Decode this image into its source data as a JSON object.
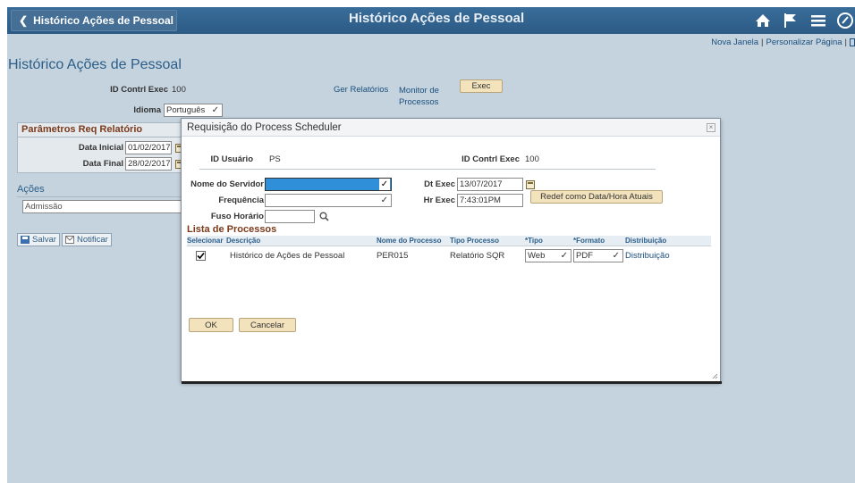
{
  "header": {
    "back_label": "Histórico Ações de Pessoal",
    "title": "Histórico Ações de Pessoal",
    "icons": [
      "home-icon",
      "flag-icon",
      "menu-icon",
      "navbar-icon"
    ]
  },
  "top_links": {
    "new_window": "Nova Janela",
    "personalize": "Personalizar Página"
  },
  "page": {
    "title": "Histórico Ações de Pessoal",
    "run_control_label": "ID Contrl Exec",
    "run_control_value": "100",
    "language_label": "Idioma",
    "language_value": "Português",
    "report_manager": "Ger Relatórios",
    "process_monitor": "Monitor de Processos",
    "run_button": "Exec"
  },
  "params": {
    "title": "Parâmetros Req Relatório",
    "start_label": "Data Inicial",
    "start_value": "01/02/2017",
    "end_label": "Data Final",
    "end_value": "28/02/2017"
  },
  "actions": {
    "title": "Ações",
    "value": "Admissão"
  },
  "side_buttons": {
    "save": "Salvar",
    "notify": "Notificar"
  },
  "modal": {
    "title": "Requisição do Process Scheduler",
    "user_label": "ID Usuário",
    "user_value": "PS",
    "run_control_label": "ID Contrl Exec",
    "run_control_value": "100",
    "server_label": "Nome do Servidor",
    "server_value": "",
    "frequency_label": "Frequência",
    "frequency_value": "",
    "timezone_label": "Fuso Horário",
    "timezone_value": "",
    "run_date_label": "Dt Exec",
    "run_date_value": "13/07/2017",
    "run_time_label": "Hr Exec",
    "run_time_value": "7:43:01PM",
    "reset_button": "Redef como Data/Hora Atuais",
    "process_list_title": "Lista de Processos",
    "columns": [
      "Selecionar",
      "Descrição",
      "Nome do Processo",
      "Tipo Processo",
      "*Tipo",
      "*Formato",
      "Distribuição"
    ],
    "rows": [
      {
        "selected": true,
        "description": "Histórico de Ações de Pessoal",
        "process_name": "PER015",
        "process_type": "Relatório SQR",
        "type": "Web",
        "format": "PDF",
        "distribution": "Distribuição"
      }
    ],
    "ok_button": "OK",
    "cancel_button": "Cancelar"
  },
  "colors": {
    "header": "#2c5a85",
    "page_bg": "#c5d3de",
    "button": "#f3e3bd",
    "section_title": "#7b3a1a",
    "link": "#1b4f7d"
  }
}
